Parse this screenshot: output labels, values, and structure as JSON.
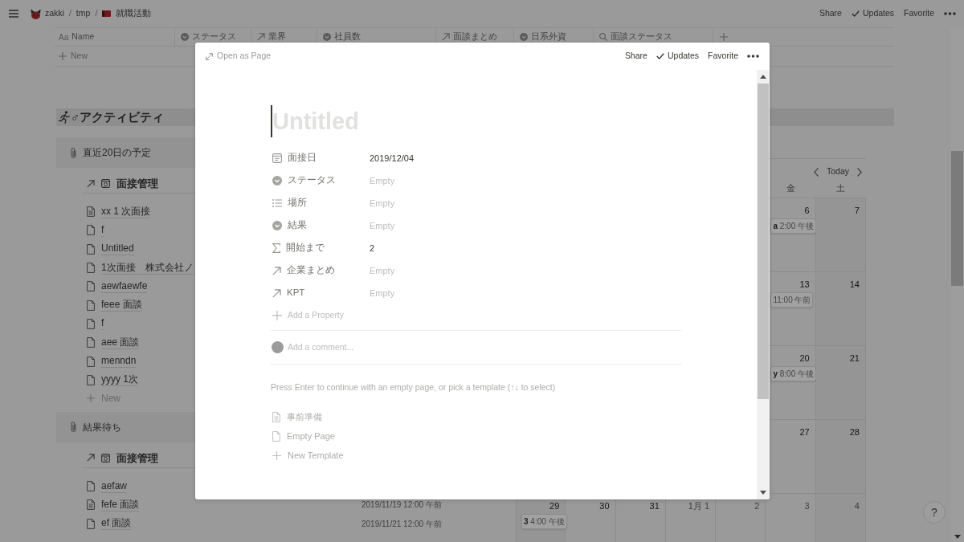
{
  "top_bar": {
    "breadcrumbs": [
      {
        "kind": "workspace",
        "label": "zakki"
      },
      {
        "kind": "separator",
        "label": "/"
      },
      {
        "kind": "page",
        "label": "tmp"
      },
      {
        "kind": "separator",
        "label": "/"
      },
      {
        "kind": "database",
        "label": "就職活動"
      }
    ],
    "actions": [
      {
        "kind": "text",
        "label": "Share"
      },
      {
        "kind": "check",
        "label": "Updates"
      },
      {
        "kind": "text",
        "label": "Favorite"
      },
      {
        "kind": "more"
      }
    ]
  },
  "table": {
    "columns": [
      {
        "kind": "title",
        "icon_text": "Aa",
        "label": "Name"
      },
      {
        "kind": "select",
        "label": "ステータス"
      },
      {
        "kind": "relation",
        "label": "業界"
      },
      {
        "kind": "select",
        "label": "社員数"
      },
      {
        "kind": "relation",
        "label": "面談まとめ"
      },
      {
        "kind": "select",
        "label": "日系外資"
      },
      {
        "kind": "rollup",
        "label": "面談ステータス"
      }
    ],
    "new_row_label": "New"
  },
  "heading": {
    "title": "♂アクティビティ"
  },
  "blocks": [
    {
      "title": "直近20日の予定",
      "view_title": "面接管理",
      "items": [
        {
          "title": "xx 1 次面接",
          "has_content": true
        },
        {
          "title": "f",
          "has_content": false
        },
        {
          "title": "Untitled",
          "has_content": false
        },
        {
          "title": "1次面接　株式会社ノ",
          "has_content": false
        },
        {
          "title": "aewfaewfe",
          "has_content": false
        },
        {
          "title": "feee 面談",
          "has_content": false
        },
        {
          "title": "f",
          "has_content": false
        },
        {
          "title": "aee 面談",
          "has_content": false
        },
        {
          "title": "menndn",
          "has_content": false
        },
        {
          "title": "yyyy 1次",
          "has_content": false
        }
      ],
      "new_label": "New"
    },
    {
      "title": "結果待ち",
      "view_title": "面接管理",
      "items": [
        {
          "title": "aefaw",
          "has_content": false
        },
        {
          "title": "fefe 面談",
          "has_content": true,
          "date": "2019/11/19 12:00 午前"
        },
        {
          "title": "ef 面談",
          "has_content": false,
          "date": "2019/11/21 12:00 午前"
        }
      ]
    }
  ],
  "calendar": {
    "nav_label": "Today",
    "weekdays": [
      "金",
      "土"
    ],
    "weeks": [
      {
        "days": [
          {
            "day": "6",
            "current_month": true,
            "events": [
              {
                "title": "a",
                "time": "2:00 午後"
              }
            ]
          },
          {
            "day": "7",
            "current_month": true
          }
        ]
      },
      {
        "days": [
          {
            "day": "13",
            "current_month": true,
            "events": [
              {
                "time": "11:00 午前"
              }
            ]
          },
          {
            "day": "14",
            "current_month": true
          }
        ]
      },
      {
        "days": [
          {
            "day": "20",
            "current_month": true,
            "events": [
              {
                "title": "y",
                "time": "8:00 午後"
              }
            ]
          },
          {
            "day": "21",
            "current_month": true
          }
        ]
      },
      {
        "days": [
          {
            "day": "27",
            "current_month": true
          },
          {
            "day": "28",
            "current_month": true
          }
        ]
      },
      {
        "days": [
          {
            "day": "29",
            "current_month": true,
            "events": [
              {
                "title": "3",
                "time": "4:00 午後"
              }
            ]
          },
          {
            "day": "30",
            "current_month": true
          },
          {
            "day": "31",
            "current_month": true
          },
          {
            "day": "1月 1",
            "current_month": false
          },
          {
            "day": "2",
            "current_month": false
          },
          {
            "day": "3",
            "current_month": false
          },
          {
            "day": "4",
            "current_month": false
          }
        ]
      }
    ]
  },
  "help_button": {
    "label": "?"
  },
  "modal": {
    "open_as_page": "Open as Page",
    "actions": [
      {
        "kind": "text",
        "label": "Share"
      },
      {
        "kind": "check",
        "label": "Updates"
      },
      {
        "kind": "text",
        "label": "Favorite"
      },
      {
        "kind": "more"
      }
    ],
    "title_placeholder": "Untitled",
    "properties": [
      {
        "kind": "date",
        "name": "面接日",
        "value": "2019/12/04",
        "empty": false
      },
      {
        "kind": "select",
        "name": "ステータス",
        "value": "Empty",
        "empty": true
      },
      {
        "kind": "multi_select",
        "name": "場所",
        "value": "Empty",
        "empty": true
      },
      {
        "kind": "select",
        "name": "結果",
        "value": "Empty",
        "empty": true
      },
      {
        "kind": "formula",
        "name": "開始まで",
        "value": "2",
        "empty": false
      },
      {
        "kind": "relation",
        "name": "企業まとめ",
        "value": "Empty",
        "empty": true
      },
      {
        "kind": "relation",
        "name": "KPT",
        "value": "Empty",
        "empty": true
      }
    ],
    "add_property": "Add a Property",
    "comment_placeholder": "Add a comment...",
    "hint": "Press Enter to continue with an empty page, or pick a template (↑↓ to select)",
    "templates": [
      {
        "kind": "template",
        "label": "事前準備"
      },
      {
        "kind": "empty_page",
        "label": "Empty Page"
      },
      {
        "kind": "new",
        "label": "New Template"
      }
    ]
  }
}
